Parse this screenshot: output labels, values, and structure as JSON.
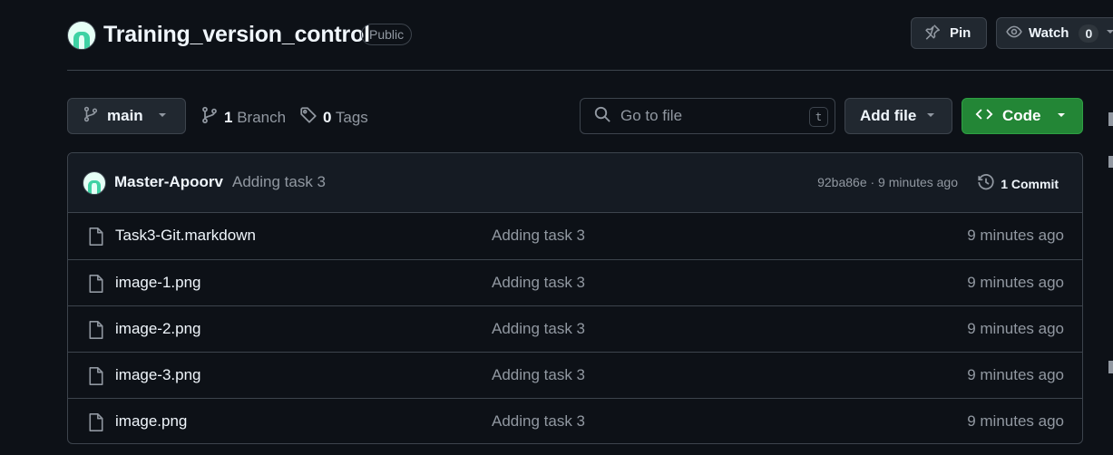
{
  "repo": {
    "name": "Training_version_control",
    "visibility": "Public"
  },
  "actions": {
    "pin_label": "Pin",
    "watch_label": "Watch",
    "watch_count": "0"
  },
  "toolbar": {
    "branch_label": "main",
    "branch_count": "1",
    "branch_word": "Branch",
    "tag_count": "0",
    "tag_word": "Tags",
    "goto_placeholder": "Go to file",
    "goto_shortcut": "t",
    "add_file_label": "Add file",
    "code_label": "Code"
  },
  "latest_commit": {
    "author": "Master-Apoorv",
    "message": "Adding task 3",
    "hash_time": "92ba86e · 9 minutes ago",
    "commits_label": "1 Commit"
  },
  "files": [
    {
      "name": "Task3-Git.markdown",
      "message": "Adding task 3",
      "time": "9 minutes ago"
    },
    {
      "name": "image-1.png",
      "message": "Adding task 3",
      "time": "9 minutes ago"
    },
    {
      "name": "image-2.png",
      "message": "Adding task 3",
      "time": "9 minutes ago"
    },
    {
      "name": "image-3.png",
      "message": "Adding task 3",
      "time": "9 minutes ago"
    },
    {
      "name": "image.png",
      "message": "Adding task 3",
      "time": "9 minutes ago"
    }
  ],
  "icons": {
    "pin": "pin-icon",
    "watch": "eye-icon",
    "branch": "git-branch-icon",
    "tag": "tag-icon",
    "search": "search-icon",
    "code": "code-icon",
    "history": "history-icon",
    "file": "file-icon"
  },
  "colors": {
    "background": "#0d1117",
    "primary_button": "#238636",
    "border": "#3d444d",
    "muted_text": "#9198a1"
  }
}
